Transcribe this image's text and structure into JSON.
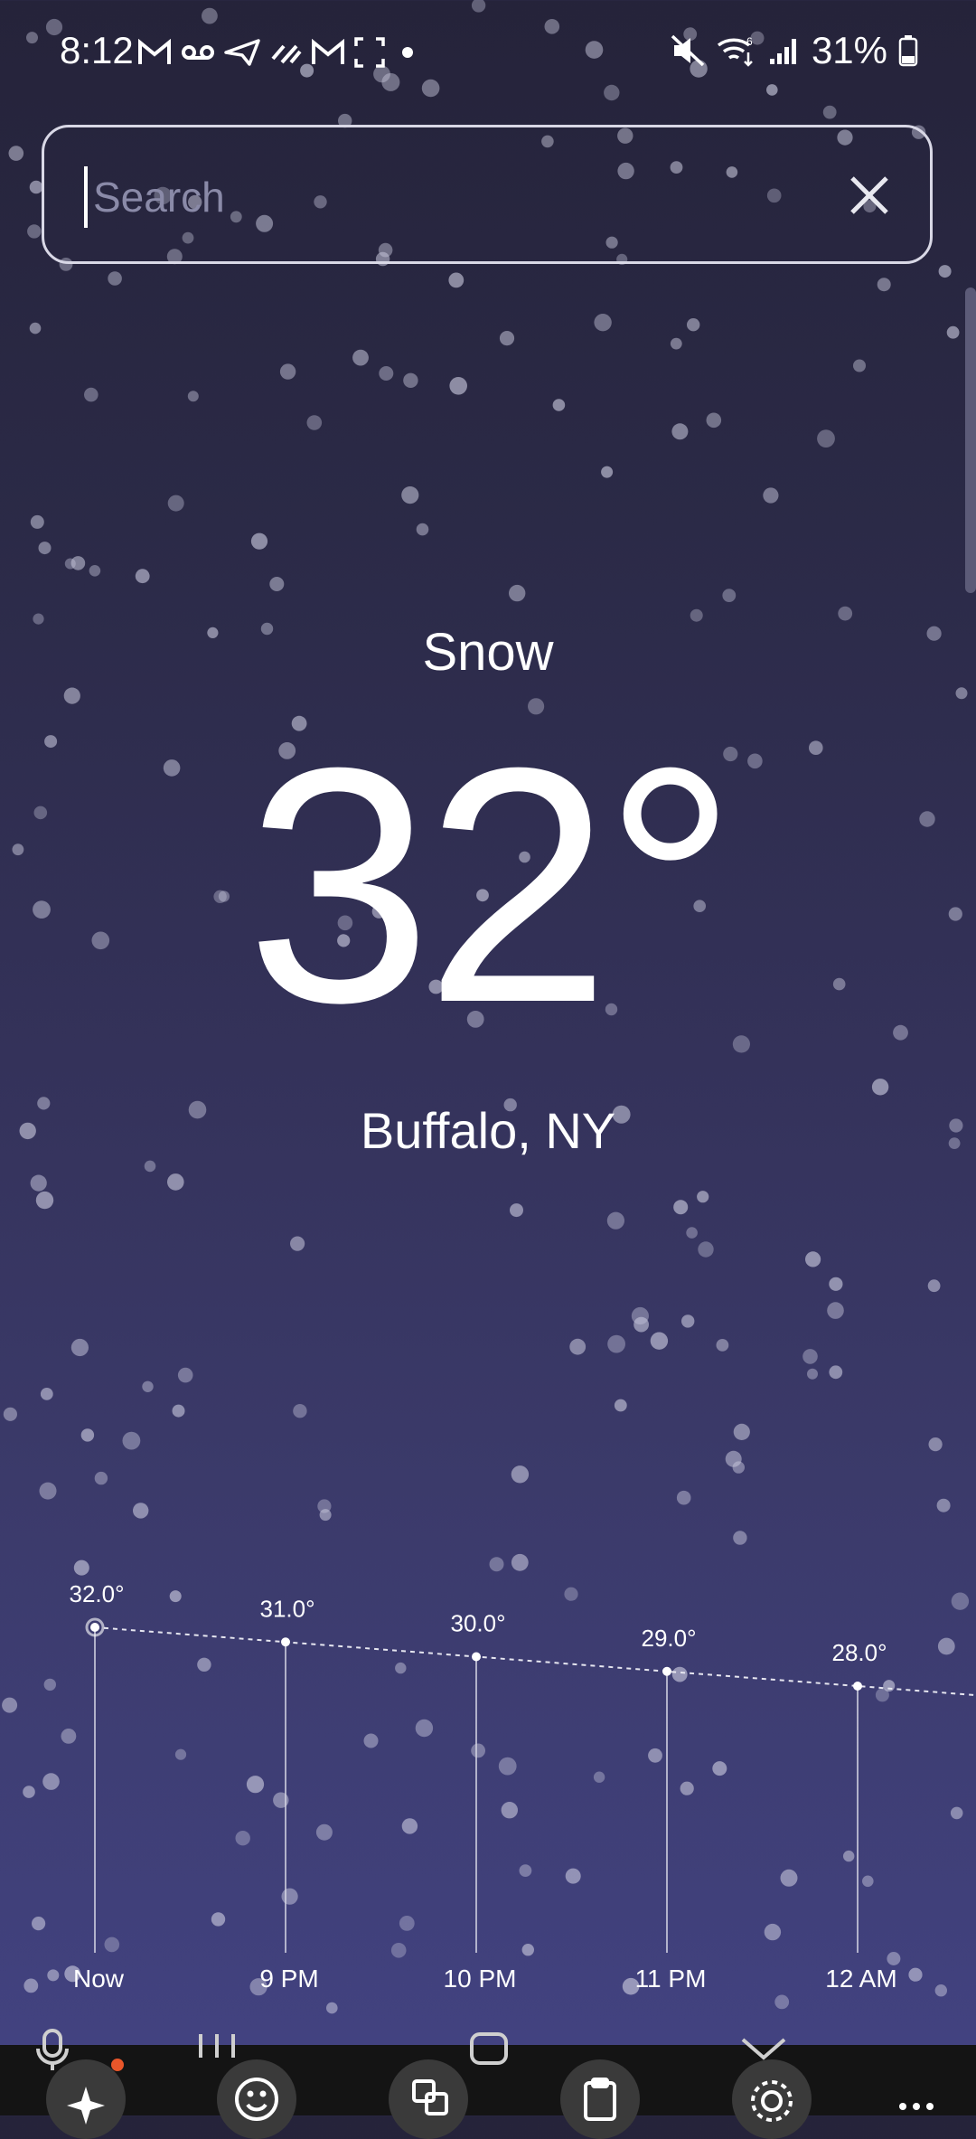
{
  "status_bar": {
    "time": "8:12",
    "battery": "31%",
    "left_icons": [
      "gmail-icon",
      "voicemail-icon",
      "send-icon",
      "data-saver-icon",
      "gmail-icon",
      "screenshot-icon",
      "dot-icon"
    ],
    "right_icons": [
      "mute-icon",
      "wifi-6-icon",
      "signal-icon",
      "battery-icon"
    ]
  },
  "search": {
    "placeholder": "Search",
    "value": ""
  },
  "weather": {
    "condition": "Snow",
    "temperature": "32°",
    "location": "Buffalo, NY"
  },
  "chart_data": {
    "type": "line",
    "categories": [
      "Now",
      "9 PM",
      "10 PM",
      "11 PM",
      "12 AM"
    ],
    "values": [
      32.0,
      31.0,
      30.0,
      29.0,
      28.0
    ],
    "data_labels": [
      "32.0°",
      "31.0°",
      "30.0°",
      "29.0°",
      "28.0°"
    ],
    "title": "",
    "xlabel": "",
    "ylabel": "",
    "ylim": [
      28,
      32
    ],
    "grid": false,
    "line_style": "dashed"
  },
  "keyboard_toolbar": {
    "icons": [
      "mic-icon",
      "ai-sparkle-icon",
      "recents-icon",
      "emoji-icon",
      "home-icon",
      "translate-icon",
      "clipboard-icon",
      "collapse-icon",
      "settings-icon",
      "more-icon"
    ]
  },
  "colors": {
    "background_top": "#25233a",
    "background_bottom": "#434383",
    "text": "#ffffff",
    "notification_dot": "#e8562a"
  }
}
